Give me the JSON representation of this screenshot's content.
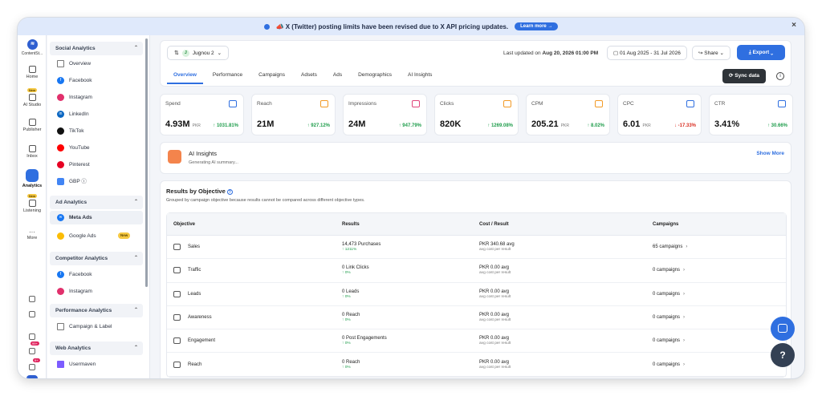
{
  "banner": {
    "message": "📣 X (Twitter) posting limits have been revised due to X API pricing updates.",
    "learn_more": "Learn more →",
    "close": "×"
  },
  "rail": {
    "brand": "ContentSt...",
    "items": [
      {
        "label": "Home"
      },
      {
        "label": "AI Studio",
        "badge": "New"
      },
      {
        "label": "Publisher"
      },
      {
        "label": "Inbox"
      },
      {
        "label": "Analytics"
      },
      {
        "label": "Listening",
        "badge": "New"
      },
      {
        "label": "More"
      }
    ],
    "notif_badge_1": "99+",
    "notif_badge_2": "9+"
  },
  "sidebar": {
    "social_analytics": {
      "title": "Social Analytics",
      "items": [
        "Overview",
        "Facebook",
        "Instagram",
        "LinkedIn",
        "TikTok",
        "YouTube",
        "Pinterest",
        "GBP ⓘ"
      ]
    },
    "ad_analytics": {
      "title": "Ad Analytics",
      "items": [
        "Meta Ads",
        "Google Ads"
      ],
      "new_badge": "New"
    },
    "competitor_analytics": {
      "title": "Competitor Analytics",
      "items": [
        "Facebook",
        "Instagram"
      ]
    },
    "performance_analytics": {
      "title": "Performance Analytics",
      "items": [
        "Campaign & Label"
      ]
    },
    "web_analytics": {
      "title": "Web Analytics",
      "items": [
        "Usermaven"
      ]
    }
  },
  "header": {
    "account": "Jugnou 2",
    "account_initial": "J",
    "last_updated_label": "Last updated on ",
    "last_updated_value": "Aug 20, 2026 01:00 PM",
    "date_range": "01 Aug 2025 - 31 Jul 2026",
    "share": "Share",
    "export": "Export",
    "sync": "Sync data",
    "tabs": [
      "Overview",
      "Performance",
      "Campaigns",
      "Adsets",
      "Ads",
      "Demographics",
      "AI Insights"
    ]
  },
  "metrics": [
    {
      "label": "Spend",
      "value": "4.93M",
      "unit": "PKR",
      "change": "↑ 1031.81%",
      "dir": "up"
    },
    {
      "label": "Reach",
      "value": "21M",
      "unit": "",
      "change": "↑ 927.12%",
      "dir": "up"
    },
    {
      "label": "Impressions",
      "value": "24M",
      "unit": "",
      "change": "↑ 947.79%",
      "dir": "up"
    },
    {
      "label": "Clicks",
      "value": "820K",
      "unit": "",
      "change": "↑ 1269.08%",
      "dir": "up"
    },
    {
      "label": "CPM",
      "value": "205.21",
      "unit": "PKR",
      "change": "↑ 8.02%",
      "dir": "up"
    },
    {
      "label": "CPC",
      "value": "6.01",
      "unit": "PKR",
      "change": "↓ -17.33%",
      "dir": "down"
    },
    {
      "label": "CTR",
      "value": "3.41%",
      "unit": "",
      "change": "↑ 30.66%",
      "dir": "up"
    }
  ],
  "ai_insights": {
    "title": "AI Insights",
    "subtitle": "Generating AI summary...",
    "show_more": "Show More"
  },
  "objectives": {
    "title": "Results by Objective",
    "subtitle": "Grouped by campaign objective because results cannot be compared across different objective types.",
    "columns": [
      "Objective",
      "Results",
      "Cost / Result",
      "Campaigns"
    ],
    "rows": [
      {
        "objective": "Sales",
        "result": "14,473 Purchases",
        "change": "↑ 1211%",
        "cost": "PKR 340.68 avg",
        "cost_sub": "avg cost per result",
        "campaigns": "65 campaigns"
      },
      {
        "objective": "Traffic",
        "result": "0 Link Clicks",
        "change": "↑ 0%",
        "cost": "PKR 0.00 avg",
        "cost_sub": "avg cost per result",
        "campaigns": "0 campaigns"
      },
      {
        "objective": "Leads",
        "result": "0 Leads",
        "change": "↑ 0%",
        "cost": "PKR 0.00 avg",
        "cost_sub": "avg cost per result",
        "campaigns": "0 campaigns"
      },
      {
        "objective": "Awareness",
        "result": "0 Reach",
        "change": "↑ 0%",
        "cost": "PKR 0.00 avg",
        "cost_sub": "avg cost per result",
        "campaigns": "0 campaigns"
      },
      {
        "objective": "Engagement",
        "result": "0 Post Engagements",
        "change": "↑ 0%",
        "cost": "PKR 0.00 avg",
        "cost_sub": "avg cost per result",
        "campaigns": "0 campaigns"
      },
      {
        "objective": "Reach",
        "result": "0 Reach",
        "change": "↑ 0%",
        "cost": "PKR 0.00 avg",
        "cost_sub": "avg cost per result",
        "campaigns": "0 campaigns"
      }
    ]
  },
  "help_fab": "?",
  "colors": {
    "accent": "#2f6fe0",
    "up": "#1f9d4c",
    "down": "#d92d20"
  }
}
